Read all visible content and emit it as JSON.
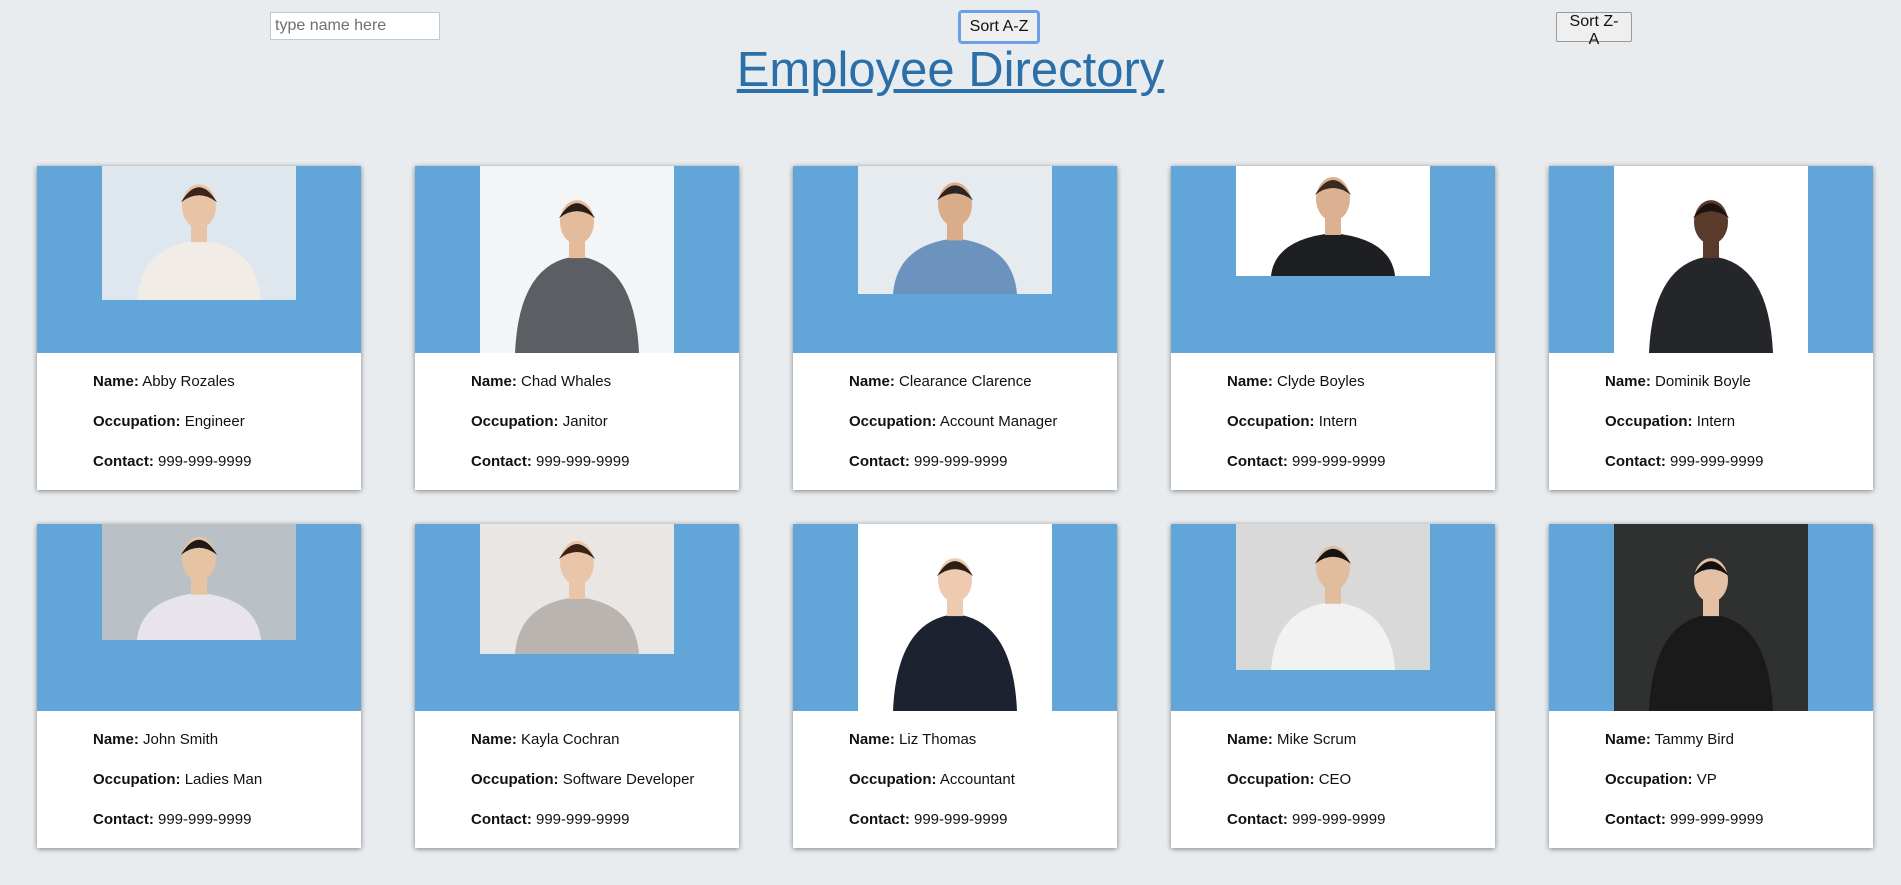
{
  "search": {
    "placeholder": "type name here"
  },
  "buttons": {
    "sort_az": "Sort A-Z",
    "sort_za": "Sort Z-A"
  },
  "page": {
    "title": "Employee Directory"
  },
  "labels": {
    "name": "Name:",
    "occupation": "Occupation:",
    "contact": "Contact:"
  },
  "colors": {
    "card_header": "#62a5d9",
    "title": "#2a6fa8",
    "background": "#e8ecef"
  },
  "employees": [
    {
      "name": "Abby Rozales",
      "occupation": "Engineer",
      "contact": "999-999-9999"
    },
    {
      "name": "Chad Whales",
      "occupation": "Janitor",
      "contact": "999-999-9999"
    },
    {
      "name": "Clearance Clarence",
      "occupation": "Account Manager",
      "contact": "999-999-9999"
    },
    {
      "name": "Clyde Boyles",
      "occupation": "Intern",
      "contact": "999-999-9999"
    },
    {
      "name": "Dominik Boyle",
      "occupation": "Intern",
      "contact": "999-999-9999"
    },
    {
      "name": "John Smith",
      "occupation": "Ladies Man",
      "contact": "999-999-9999"
    },
    {
      "name": "Kayla Cochran",
      "occupation": "Software Developer",
      "contact": "999-999-9999"
    },
    {
      "name": "Liz Thomas",
      "occupation": "Accountant",
      "contact": "999-999-9999"
    },
    {
      "name": "Mike Scrum",
      "occupation": "CEO",
      "contact": "999-999-9999"
    },
    {
      "name": "Tammy Bird",
      "occupation": "VP",
      "contact": "999-999-9999"
    }
  ]
}
